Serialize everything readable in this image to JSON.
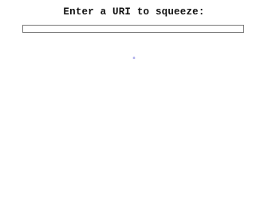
{
  "header": {
    "title": "Enter a URI to squeeze:"
  },
  "form": {
    "uri_value": "",
    "uri_placeholder": ""
  },
  "footer": {
    "link_text": "...",
    "link_color": "#3333cc"
  }
}
